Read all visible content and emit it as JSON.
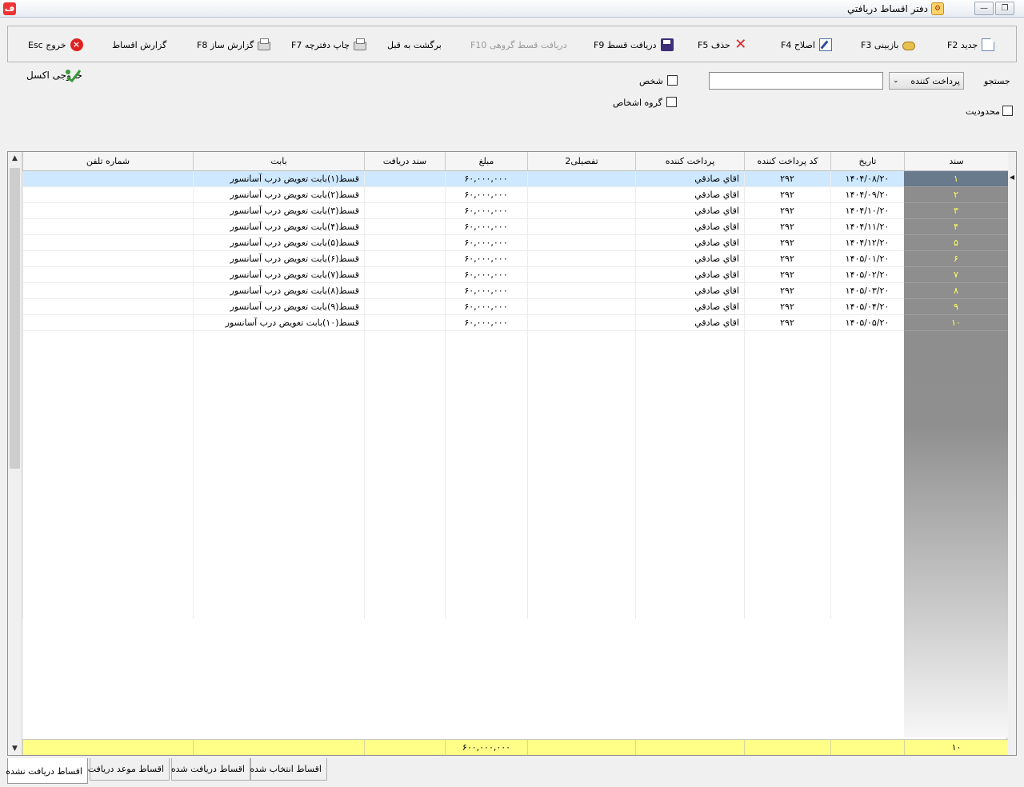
{
  "window": {
    "title": "دفتر اقساط دریافتي"
  },
  "toolbar": {
    "new_label": "جدید F2",
    "view_label": "بازبینی F3",
    "edit_label": "اصلاح F4",
    "delete_label": "حذف  F5",
    "receive_label": "دریافت قسط F9",
    "group_receive_label": "دریافت قسط گروهی F10",
    "back_label": "برگشت به قبل",
    "print_label": "چاپ دفترچه F7",
    "report_builder_label": "گزارش ساز F8",
    "report_label": "گزارش اقساط",
    "exit_label": "خروج Esc"
  },
  "search": {
    "label": "جستجو",
    "field_value": "پرداخت کننده",
    "input_value": "",
    "person_label": "شخص",
    "group_label": "گروه اشخاص",
    "limit_label": "محدودیت",
    "excel_label": "خروجی اکسل"
  },
  "grid": {
    "columns": [
      "سند",
      "تاریخ",
      "کد پرداخت کننده",
      "پرداخت کننده",
      "تفصیلی2",
      "مبلغ",
      "سند دریافت",
      "بابت",
      "شماره تلفن"
    ],
    "rows": [
      {
        "sanad": "۱",
        "date": "۱۴۰۴/۰۸/۲۰",
        "code": "۲۹۲",
        "payer": "اقاي صادقي",
        "detail2": "",
        "amount": "۶۰,۰۰۰,۰۰۰",
        "doc": "",
        "for": "قسط(۱)بابت تعويض درب آسانسور",
        "phone": ""
      },
      {
        "sanad": "۲",
        "date": "۱۴۰۴/۰۹/۲۰",
        "code": "۲۹۲",
        "payer": "اقاي صادقي",
        "detail2": "",
        "amount": "۶۰,۰۰۰,۰۰۰",
        "doc": "",
        "for": "قسط(۲)بابت تعويض درب آسانسور",
        "phone": ""
      },
      {
        "sanad": "۳",
        "date": "۱۴۰۴/۱۰/۲۰",
        "code": "۲۹۲",
        "payer": "اقاي صادقي",
        "detail2": "",
        "amount": "۶۰,۰۰۰,۰۰۰",
        "doc": "",
        "for": "قسط(۳)بابت تعويض درب آسانسور",
        "phone": ""
      },
      {
        "sanad": "۴",
        "date": "۱۴۰۴/۱۱/۲۰",
        "code": "۲۹۲",
        "payer": "اقاي صادقي",
        "detail2": "",
        "amount": "۶۰,۰۰۰,۰۰۰",
        "doc": "",
        "for": "قسط(۴)بابت تعويض درب آسانسور",
        "phone": ""
      },
      {
        "sanad": "۵",
        "date": "۱۴۰۴/۱۲/۲۰",
        "code": "۲۹۲",
        "payer": "اقاي صادقي",
        "detail2": "",
        "amount": "۶۰,۰۰۰,۰۰۰",
        "doc": "",
        "for": "قسط(۵)بابت تعويض درب آسانسور",
        "phone": ""
      },
      {
        "sanad": "۶",
        "date": "۱۴۰۵/۰۱/۲۰",
        "code": "۲۹۲",
        "payer": "اقاي صادقي",
        "detail2": "",
        "amount": "۶۰,۰۰۰,۰۰۰",
        "doc": "",
        "for": "قسط(۶)بابت تعويض درب آسانسور",
        "phone": ""
      },
      {
        "sanad": "۷",
        "date": "۱۴۰۵/۰۲/۲۰",
        "code": "۲۹۲",
        "payer": "اقاي صادقي",
        "detail2": "",
        "amount": "۶۰,۰۰۰,۰۰۰",
        "doc": "",
        "for": "قسط(۷)بابت تعويض درب آسانسور",
        "phone": ""
      },
      {
        "sanad": "۸",
        "date": "۱۴۰۵/۰۳/۲۰",
        "code": "۲۹۲",
        "payer": "اقاي صادقي",
        "detail2": "",
        "amount": "۶۰,۰۰۰,۰۰۰",
        "doc": "",
        "for": "قسط(۸)بابت تعويض درب آسانسور",
        "phone": ""
      },
      {
        "sanad": "۹",
        "date": "۱۴۰۵/۰۴/۲۰",
        "code": "۲۹۲",
        "payer": "اقاي صادقي",
        "detail2": "",
        "amount": "۶۰,۰۰۰,۰۰۰",
        "doc": "",
        "for": "قسط(۹)بابت تعويض درب آسانسور",
        "phone": ""
      },
      {
        "sanad": "۱۰",
        "date": "۱۴۰۵/۰۵/۲۰",
        "code": "۲۹۲",
        "payer": "اقاي صادقي",
        "detail2": "",
        "amount": "۶۰,۰۰۰,۰۰۰",
        "doc": "",
        "for": "قسط(۱۰)بابت تعويض درب آسانسور",
        "phone": ""
      }
    ],
    "selected_row": 0,
    "footer": {
      "count": "۱۰",
      "amount_total": "۶۰۰,۰۰۰,۰۰۰"
    }
  },
  "tabs": [
    "اقساط دریافت نشده",
    "اقساط موعد دریافت",
    "اقساط دریافت شده",
    "اقساط انتخاب شده"
  ],
  "active_tab": 0,
  "colors": {
    "selected_row": "#cde8ff",
    "sanad_text": "#ffff66",
    "footer_bg": "#ffff88"
  }
}
